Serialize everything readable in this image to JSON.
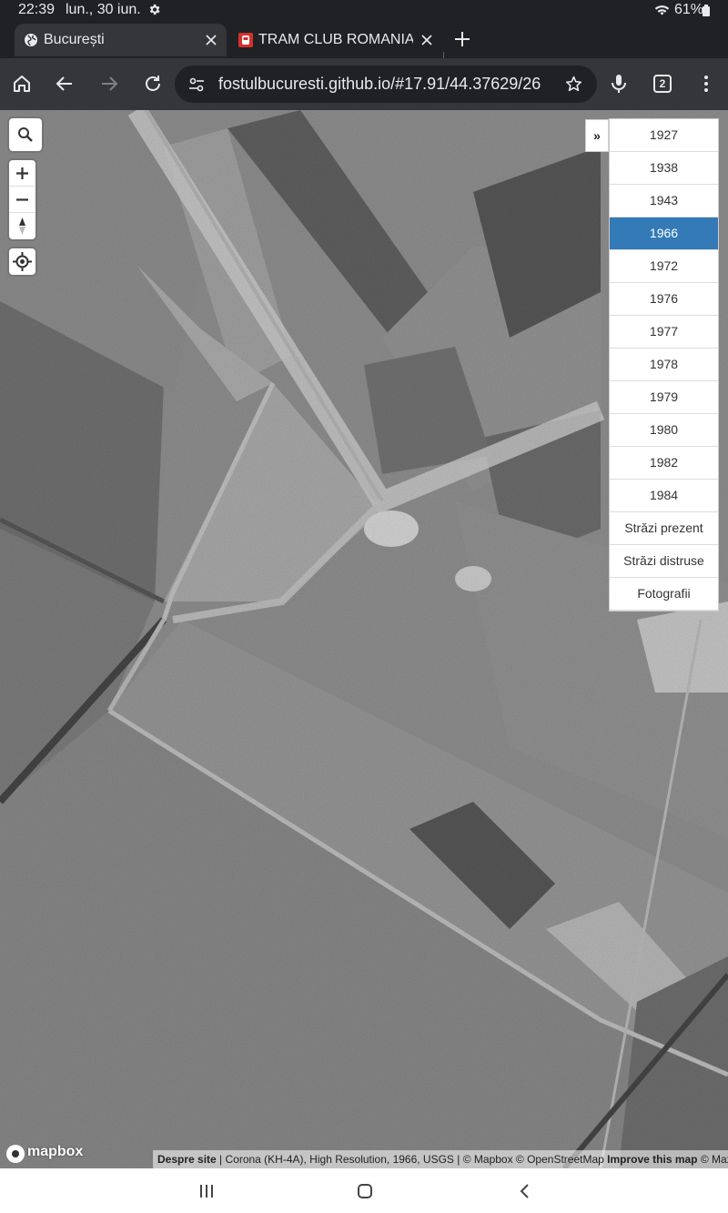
{
  "status": {
    "time": "22:39",
    "date": "lun., 30 iun.",
    "battery": "61%"
  },
  "tabs": [
    {
      "title": "București",
      "active": true
    },
    {
      "title": "TRAM CLUB ROMANIA :: ",
      "active": false
    }
  ],
  "toolbar": {
    "url": "fostulbucuresti.github.io/#17.91/44.37629/26",
    "tab_count": "2"
  },
  "map": {
    "layer_toggle": "»",
    "layers": [
      "1927",
      "1938",
      "1943",
      "1966",
      "1972",
      "1976",
      "1977",
      "1978",
      "1979",
      "1980",
      "1982",
      "1984",
      "Străzi prezent",
      "Străzi distruse",
      "Fotografii"
    ],
    "selected_layer": "1966",
    "logo": "mapbox",
    "attribution": {
      "despre": "Despre site",
      "source": " | Corona (KH-4A), High Resolution, 1966, USGS | © Mapbox © OpenStreetMap ",
      "improve": "Improve this map",
      "maxar": " © Maxar"
    }
  },
  "colors": {
    "selected": "#337ab7",
    "toolbar": "#35363a",
    "statusbar": "#202124"
  }
}
